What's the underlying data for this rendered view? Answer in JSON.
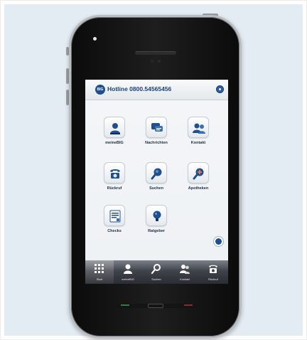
{
  "header": {
    "logo_text": "BIG",
    "hotline": "Hotline 0800.54565456"
  },
  "tiles": [
    {
      "label": "meineBIG",
      "icon": "person-icon"
    },
    {
      "label": "Nachrichten",
      "icon": "chat-icon"
    },
    {
      "label": "Kontakt",
      "icon": "contacts-icon"
    },
    {
      "label": "Rückruf",
      "icon": "phone-icon"
    },
    {
      "label": "Suchen",
      "icon": "search-icon"
    },
    {
      "label": "Apotheken",
      "icon": "pharmacy-search-icon"
    },
    {
      "label": "Checks",
      "icon": "checklist-icon"
    },
    {
      "label": "Ratgeber",
      "icon": "lightbulb-icon"
    }
  ],
  "tabbar": [
    {
      "label": "Start",
      "icon": "grid-icon",
      "active": true
    },
    {
      "label": "meineBIG",
      "icon": "person-icon"
    },
    {
      "label": "Suchen",
      "icon": "search-icon"
    },
    {
      "label": "Kontakt",
      "icon": "contacts-icon"
    },
    {
      "label": "Rückruf",
      "icon": "phone-icon"
    }
  ],
  "colors": {
    "brand_blue": "#1d4f91",
    "background": "#e4ecf3",
    "tabbar_dark": "#2a2d33"
  }
}
